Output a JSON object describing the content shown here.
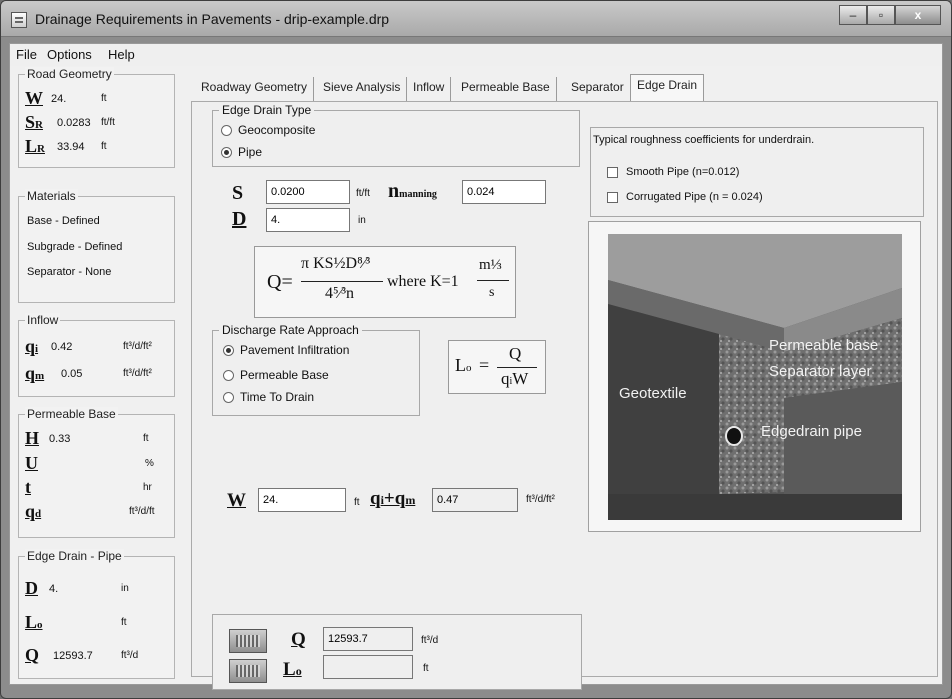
{
  "window": {
    "title": "Drainage Requirements in Pavements - drip-example.drp"
  },
  "menu": {
    "file": "File",
    "options": "Options",
    "help": "Help"
  },
  "road_geometry": {
    "title": "Road Geometry",
    "w": {
      "sym": "W",
      "value": "24.",
      "unit": "ft"
    },
    "sr": {
      "sym": "S",
      "sub": "R",
      "value": "0.0283",
      "unit": "ft/ft"
    },
    "lr": {
      "sym": "L",
      "sub": "R",
      "value": "33.94",
      "unit": "ft"
    }
  },
  "materials": {
    "title": "Materials",
    "items": [
      "Base - Defined",
      "Subgrade - Defined",
      "Separator - None"
    ]
  },
  "inflow": {
    "title": "Inflow",
    "qi": {
      "sym": "q",
      "sub": "i",
      "value": "0.42",
      "unit": "ft³/d/ft²"
    },
    "qm": {
      "sym": "q",
      "sub": "m",
      "value": "0.05",
      "unit": "ft³/d/ft²"
    }
  },
  "permeable_base": {
    "title": "Permeable Base",
    "h": {
      "sym": "H",
      "value": "0.33",
      "unit": "ft"
    },
    "u": {
      "sym": "U",
      "value": "",
      "unit": "%"
    },
    "t": {
      "sym": "t",
      "value": "",
      "unit": "hr"
    },
    "qd": {
      "sym": "q",
      "sub": "d",
      "value": "",
      "unit": "ft³/d/ft"
    }
  },
  "edge_drain_pipe": {
    "title": "Edge Drain - Pipe",
    "d": {
      "sym": "D",
      "value": "4.",
      "unit": "in"
    },
    "lo": {
      "sym": "L",
      "sub": "o",
      "value": "",
      "unit": "ft"
    },
    "q": {
      "sym": "Q",
      "value": "12593.7",
      "unit": "ft³/d"
    }
  },
  "tabs": [
    "Roadway Geometry",
    "Sieve Analysis",
    "Inflow",
    "Permeable Base",
    "Separator",
    "Edge Drain"
  ],
  "edge_drain_tab": {
    "type_group": {
      "title": "Edge Drain Type",
      "options": [
        "Geocomposite",
        "Pipe"
      ],
      "selected": "Pipe"
    },
    "s_label": "S",
    "s_value": "0.0200",
    "s_unit": "ft/ft",
    "n_label": "n",
    "n_sub": "manning",
    "n_value": "0.024",
    "d_label": "D",
    "d_value": "4.",
    "d_unit": "in",
    "formula1": {
      "lhs": "Q=",
      "num": "π KS½D⁸⁄³",
      "den": "4⁵⁄³n",
      "mid": "where K=1",
      "kunit_num": "m⅓",
      "kunit_den": "s"
    },
    "discharge_group": {
      "title": "Discharge Rate Approach",
      "options": [
        "Pavement Infiltration",
        "Permeable Base",
        "Time To Drain"
      ],
      "selected": "Pavement Infiltration"
    },
    "formula2": {
      "lhs": "L",
      "lhs_sub": "o",
      "eq": "=",
      "num": "Q",
      "den": "q",
      "den_sub": "i",
      "den_tail": "W"
    },
    "w_label": "W",
    "w_value": "24.",
    "w_unit": "ft",
    "qiqm_label": "q",
    "qiqm_sub_i": "i",
    "qiqm_plus": "+q",
    "qiqm_sub_m": "m",
    "qiqm_value": "0.47",
    "qiqm_unit": "ft³/d/ft²",
    "rough_group": {
      "title": "Typical roughness coefficients for underdrain.",
      "options": [
        "Smooth Pipe (n=0.012)",
        "Corrugated Pipe (n = 0.024)"
      ]
    },
    "schematic": {
      "permeable": "Permeable base",
      "separator": "Separator layer",
      "geotextile": "Geotextile",
      "pipe": "Edgedrain pipe"
    },
    "result_q": {
      "label": "Q",
      "value": "12593.7",
      "unit": "ft³/d"
    },
    "result_lo": {
      "label": "L",
      "sub": "o",
      "value": "",
      "unit": "ft"
    }
  }
}
